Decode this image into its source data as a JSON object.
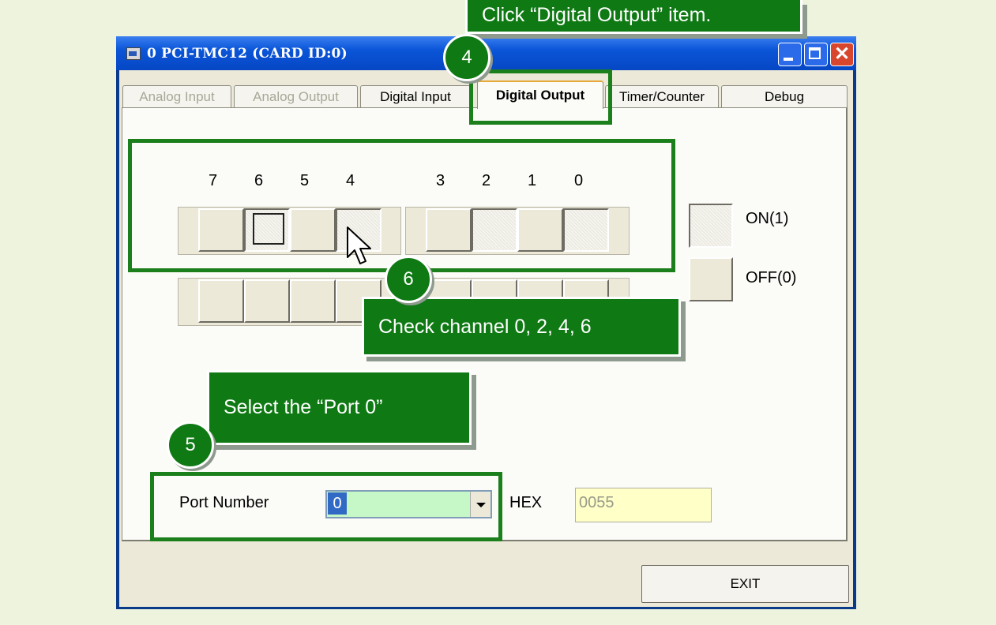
{
  "window": {
    "title": "0 PCI-TMC12 (CARD ID:0)"
  },
  "tabs": [
    {
      "label": "Analog Input"
    },
    {
      "label": "Analog Output"
    },
    {
      "label": "Digital Input"
    },
    {
      "label": "Digital Output"
    },
    {
      "label": "Timer/Counter"
    },
    {
      "label": "Debug"
    }
  ],
  "bits": [
    "7",
    "6",
    "5",
    "4",
    "3",
    "2",
    "1",
    "0"
  ],
  "output_states": [
    0,
    1,
    0,
    1,
    0,
    1,
    0,
    1
  ],
  "legend": {
    "on_label": "ON(1)",
    "off_label": "OFF(0)"
  },
  "port": {
    "label": "Port Number",
    "value": "0"
  },
  "hex": {
    "label": "HEX",
    "value": "0055"
  },
  "exit_label": "EXIT",
  "callouts": {
    "step4_text": "Click “Digital Output” item.",
    "step4_num": "4",
    "step5_text": "Select the “Port 0”",
    "step5_num": "5",
    "step6_text": "Check channel 0, 2, 4, 6",
    "step6_num": "6"
  },
  "colors": {
    "annotation_green": "#0f7a14",
    "titlebar_blue": "#0a55d8",
    "port_field_bg": "#c6f7c6",
    "hex_field_bg": "#ffffc8"
  }
}
